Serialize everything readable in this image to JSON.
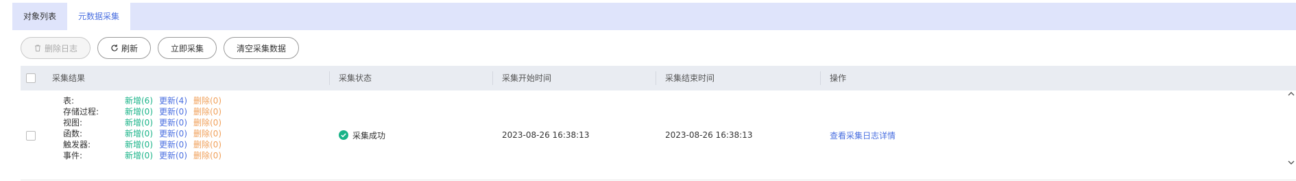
{
  "tabs": [
    {
      "label": "对象列表",
      "active": false
    },
    {
      "label": "元数据采集",
      "active": true
    }
  ],
  "toolbar": {
    "delete_log": "删除日志",
    "refresh": "刷新",
    "collect_now": "立即采集",
    "clear_data": "清空采集数据"
  },
  "table": {
    "headers": [
      "采集结果",
      "采集状态",
      "采集开始时间",
      "采集结束时间",
      "操作"
    ],
    "rows": [
      {
        "results": [
          {
            "label": "表:",
            "add": "新增(6)",
            "update": "更新(4)",
            "delete": "删除(0)"
          },
          {
            "label": "存储过程:",
            "add": "新增(0)",
            "update": "更新(0)",
            "delete": "删除(0)"
          },
          {
            "label": "视图:",
            "add": "新增(0)",
            "update": "更新(0)",
            "delete": "删除(0)"
          },
          {
            "label": "函数:",
            "add": "新增(0)",
            "update": "更新(0)",
            "delete": "删除(0)"
          },
          {
            "label": "触发器:",
            "add": "新增(0)",
            "update": "更新(0)",
            "delete": "删除(0)"
          },
          {
            "label": "事件:",
            "add": "新增(0)",
            "update": "更新(0)",
            "delete": "删除(0)"
          }
        ],
        "status": "采集成功",
        "start_time": "2023-08-26 16:38:13",
        "end_time": "2023-08-26 16:38:13",
        "action": "查看采集日志详情"
      }
    ]
  },
  "colors": {
    "accent": "#4a6fe0",
    "add": "#19b388",
    "delete": "#f0a05a",
    "success": "#19b388",
    "tabbar_bg": "#dfe4fb"
  },
  "icons": {
    "delete_log": "trash-icon",
    "refresh": "refresh-icon",
    "status": "check-circle-icon"
  }
}
